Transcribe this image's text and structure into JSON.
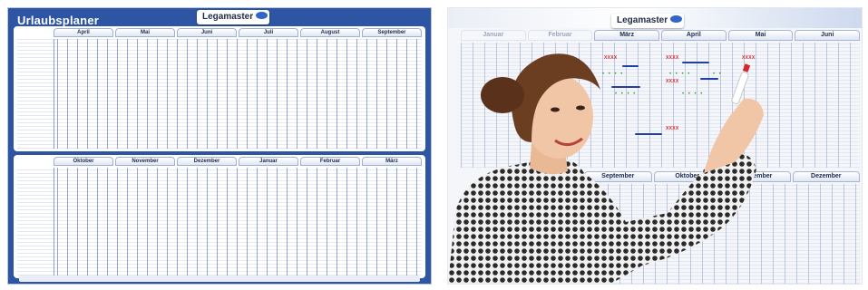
{
  "left_planner": {
    "title": "Urlaubsplaner",
    "logo_text": "Legamaster",
    "top_months": [
      "April",
      "Mai",
      "Juni",
      "Juli",
      "August",
      "September"
    ],
    "bottom_months": [
      "Oktober",
      "November",
      "Dezember",
      "Januar",
      "Februar",
      "März"
    ]
  },
  "right_photo": {
    "logo_text": "Legamaster",
    "top_months": [
      "Januar",
      "Februar",
      "März",
      "April",
      "Mai",
      "Juni"
    ],
    "bottom_months": [
      "September",
      "Oktober",
      "November",
      "Dezember"
    ],
    "red_mark": "XXXX"
  },
  "colors": {
    "board_blue": "#2d55a4",
    "marker_blue": "#1f3fa8",
    "marker_red": "#d8262b",
    "marker_green": "#2a9a32"
  }
}
